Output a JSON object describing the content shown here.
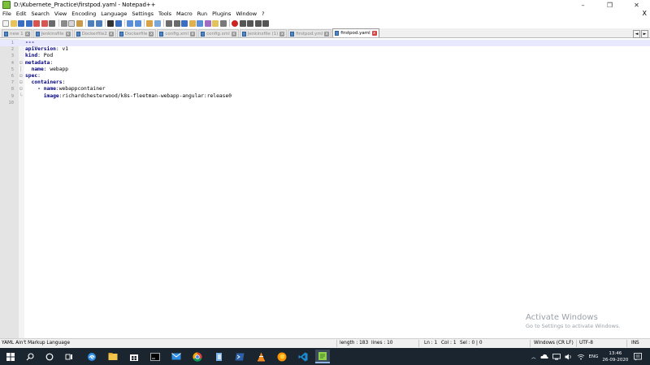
{
  "window": {
    "title": "D:\\Kubernete_Practice\\firstpod.yaml - Notepad++",
    "minimize": "–",
    "maximize": "❐",
    "close": "✕"
  },
  "menu": {
    "items": [
      "File",
      "Edit",
      "Search",
      "View",
      "Encoding",
      "Language",
      "Settings",
      "Tools",
      "Macro",
      "Run",
      "Plugins",
      "Window",
      "?"
    ],
    "close_doc": "X"
  },
  "toolbar": {
    "buttons": [
      "new-file-icon",
      "open-file-icon",
      "save-icon",
      "save-all-icon",
      "close-icon",
      "close-all-icon",
      "print-icon",
      "cut-icon",
      "copy-icon",
      "paste-icon",
      "undo-icon",
      "redo-icon",
      "find-icon",
      "replace-icon",
      "zoom-in-icon",
      "zoom-out-icon",
      "sync-v-icon",
      "sync-h-icon",
      "word-wrap-icon",
      "all-chars-icon",
      "indent-guide-icon",
      "udl-icon",
      "doc-map-icon",
      "function-list-icon",
      "folder-workspace-icon",
      "monitor-icon",
      "record-macro-icon",
      "stop-record-icon",
      "play-macro-icon",
      "play-multiple-icon",
      "save-macro-icon"
    ]
  },
  "tabs": [
    {
      "label": "new 1",
      "active": false
    },
    {
      "label": "Jenkinsfile",
      "active": false
    },
    {
      "label": "Dockerfile2",
      "active": false
    },
    {
      "label": "Dockerfile",
      "active": false
    },
    {
      "label": "config.xml",
      "active": false
    },
    {
      "label": "config.xml",
      "active": false
    },
    {
      "label": "Jenkinsfile (1)",
      "active": false
    },
    {
      "label": "firstpod.yml",
      "active": false
    },
    {
      "label": "firstpod.yaml",
      "active": true
    }
  ],
  "tab_scroll": {
    "left": "◄",
    "right": "►"
  },
  "editor": {
    "lines": [
      {
        "n": "1",
        "fold": "",
        "indent": "",
        "key": "---",
        "sep": "",
        "val": ""
      },
      {
        "n": "2",
        "fold": "",
        "indent": "",
        "key": "apiVersion",
        "sep": ":",
        "val": " v1"
      },
      {
        "n": "3",
        "fold": "",
        "indent": "",
        "key": "kind",
        "sep": ":",
        "val": " Pod"
      },
      {
        "n": "4",
        "fold": "⊟",
        "indent": "",
        "key": "metadata",
        "sep": ":",
        "val": ""
      },
      {
        "n": "5",
        "fold": "│",
        "indent": "  ",
        "key": "name",
        "sep": ":",
        "val": " webapp"
      },
      {
        "n": "6",
        "fold": "⊟",
        "indent": "",
        "key": "spec",
        "sep": ":",
        "val": ""
      },
      {
        "n": "7",
        "fold": "⊟",
        "indent": "  ",
        "key": "containers",
        "sep": ":",
        "val": ""
      },
      {
        "n": "8",
        "fold": "⊟",
        "indent": "    - ",
        "key": "name",
        "sep": ":",
        "val": "webappcontainer"
      },
      {
        "n": "9",
        "fold": "└",
        "indent": "      ",
        "key": "image",
        "sep": ":",
        "val": "richardchesterwood/k8s-fleetman-webapp-angular:release0"
      },
      {
        "n": "10",
        "fold": "",
        "indent": "",
        "key": "",
        "sep": "",
        "val": ""
      }
    ]
  },
  "watermark": {
    "title": "Activate Windows",
    "subtitle": "Go to Settings to activate Windows."
  },
  "status": {
    "language": "YAML Ain't Markup Language",
    "length": "length : 183",
    "lines": "lines : 10",
    "ln": "Ln : 1",
    "col": "Col : 1",
    "sel": "Sel : 0 | 0",
    "eol": "Windows (CR LF)",
    "encoding": "UTF-8",
    "mode": "INS"
  },
  "taskbar": {
    "time": "13:46",
    "date": "26-09-2020",
    "lang": "ENG",
    "apps": [
      "start-icon",
      "search-icon",
      "cortana-icon",
      "task-view-icon",
      "edge-icon",
      "file-explorer-icon",
      "store-icon",
      "terminal-icon",
      "mail-icon",
      "chrome-icon",
      "app-icon",
      "powershell-icon",
      "vlc-icon",
      "firefox-icon",
      "vscode-icon",
      "notepadpp-icon"
    ],
    "colors": {
      "bg": "#1b2530",
      "active_underline": "#8fb4e3"
    }
  },
  "colors": {
    "yaml_key": "#000080",
    "tab_close_active": "#d24444",
    "gutter": "#e4e4e4"
  }
}
